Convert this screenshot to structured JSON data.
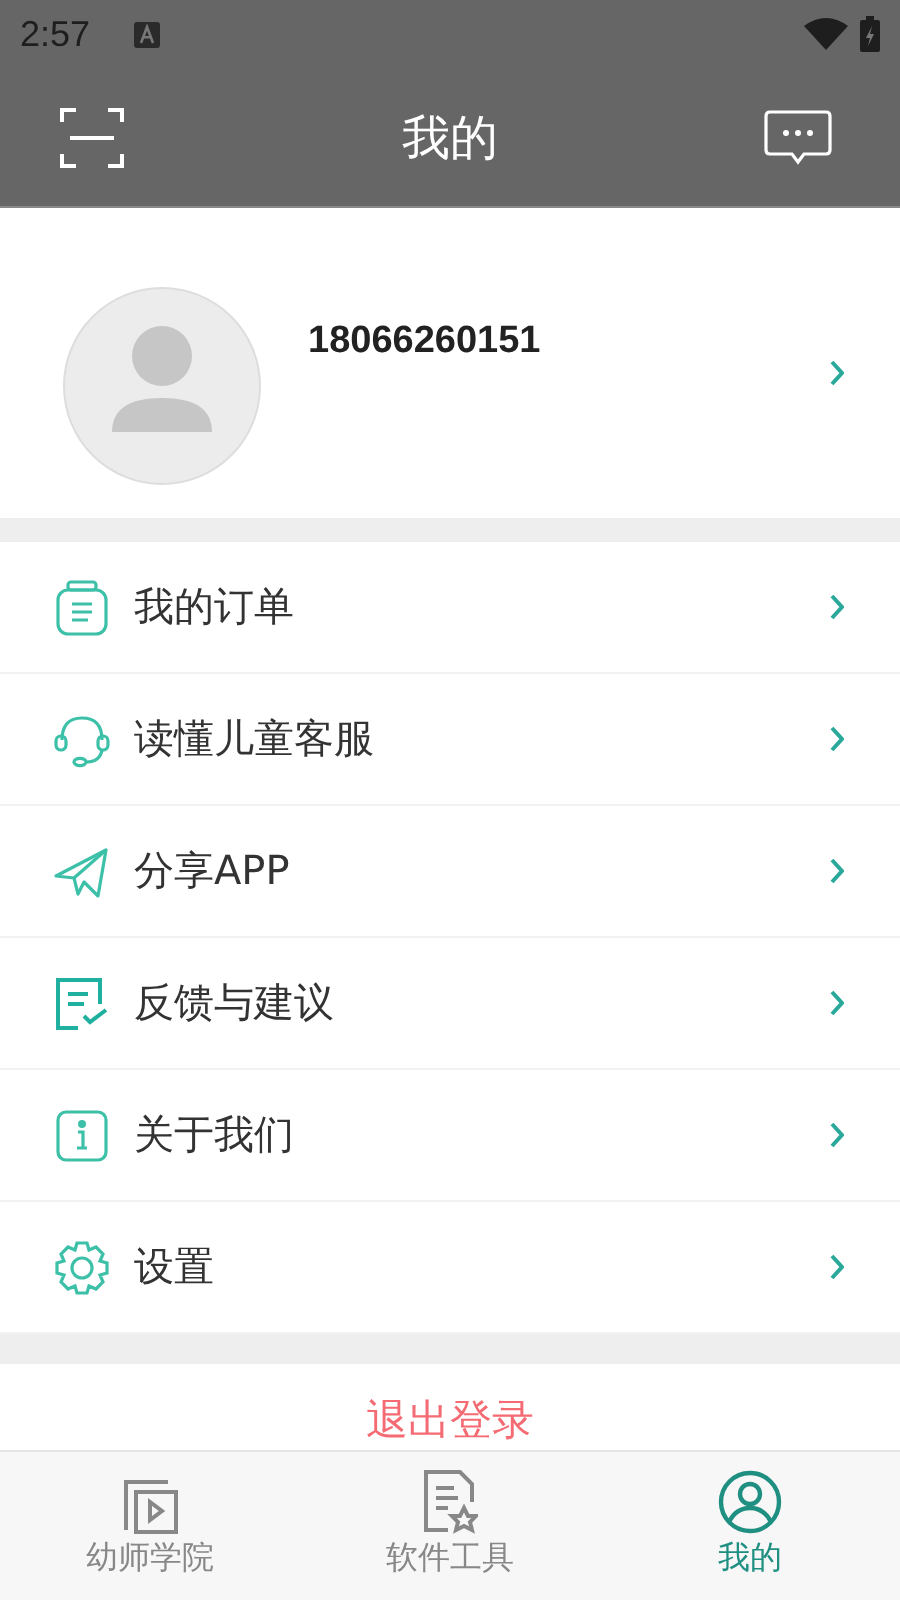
{
  "status_bar": {
    "time": "2:57"
  },
  "header": {
    "title": "我的"
  },
  "profile": {
    "phone": "18066260151"
  },
  "menu": [
    {
      "kind": "order",
      "label": "我的订单"
    },
    {
      "kind": "service",
      "label": "读懂儿童客服"
    },
    {
      "kind": "share",
      "label": "分享APP"
    },
    {
      "kind": "feedback",
      "label": "反馈与建议"
    },
    {
      "kind": "about",
      "label": "关于我们"
    },
    {
      "kind": "settings",
      "label": "设置"
    }
  ],
  "logout": {
    "label": "退出登录"
  },
  "tabs": [
    {
      "kind": "academy",
      "label": "幼师学院",
      "selected": false
    },
    {
      "kind": "tools",
      "label": "软件工具",
      "selected": false
    },
    {
      "kind": "mine",
      "label": "我的",
      "selected": true
    }
  ]
}
